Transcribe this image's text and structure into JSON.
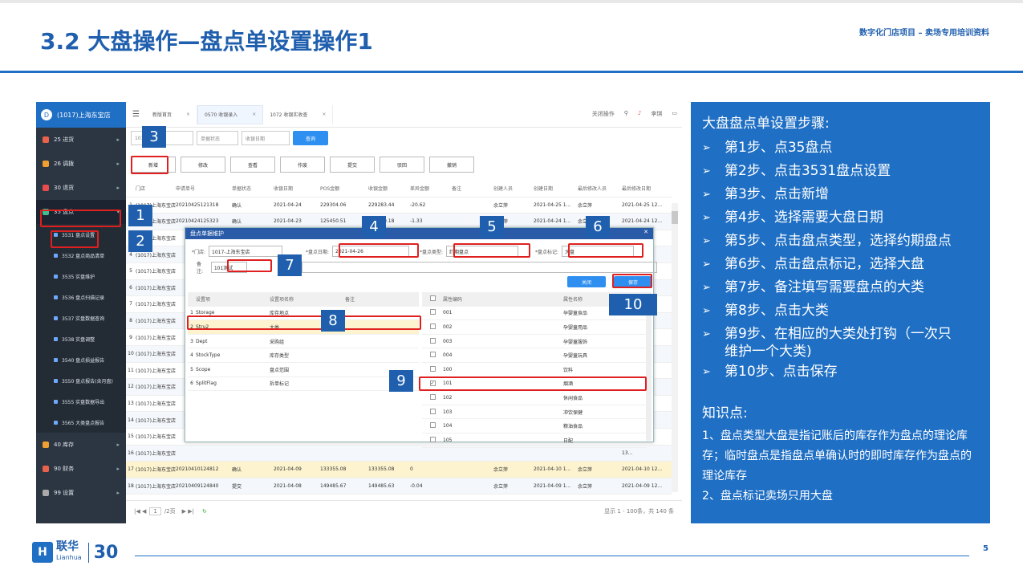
{
  "slide": {
    "title": "3.2 大盘操作—盘点单设置操作1",
    "subtitle": "数字化门店项目 – 卖场专用培训资料",
    "page_number": "5",
    "logo_cn": "联华",
    "logo_en": "Lianhua",
    "logo_years": "30"
  },
  "app": {
    "store_title": "(1017)上海东宝店",
    "menu": [
      {
        "label": "25 进货",
        "icon": "cart-icon",
        "color": "#e8624c"
      },
      {
        "label": "26 调拨",
        "icon": "transfer-icon",
        "color": "#f0a030"
      },
      {
        "label": "30 退货",
        "icon": "return-icon",
        "color": "#e84c4c"
      },
      {
        "label": "35 盘点",
        "icon": "inventory-icon",
        "color": "#3fbf8f"
      }
    ],
    "submenu": [
      "3531 盘点设置",
      "3532 盘点商品清单",
      "3535 实盘维护",
      "3536 盘点扫描记录",
      "3537 实盘数据查询",
      "3538 实盘调整",
      "3540 盘点损益报告",
      "3550 盘点报告(含月盘)",
      "3555 实盘数据导出",
      "3565 大类盘点报告"
    ],
    "menu_bottom": [
      {
        "label": "40 库存",
        "icon": "stock-icon",
        "color": "#f0a030"
      },
      {
        "label": "90 财务",
        "icon": "finance-icon",
        "color": "#e8624c"
      },
      {
        "label": "99 设置",
        "icon": "settings-icon",
        "color": "#aaaaaa"
      }
    ],
    "tabs": [
      "新版首页",
      "0570 收银录入",
      "1072 收银实收查"
    ],
    "topbar_right": [
      "关闭操作",
      "李琪"
    ],
    "filters": {
      "store": "1017",
      "status": "单据状态",
      "date": "收银日期",
      "query": "查询"
    },
    "buttons": [
      "新增",
      "修改",
      "查看",
      "作废",
      "提交",
      "驳回",
      "撤销"
    ],
    "columns": [
      "门店",
      "申请单号",
      "单据状态",
      "收银日期",
      "POS金额",
      "收银金额",
      "差异金额",
      "备注",
      "创建人员",
      "创建日期",
      "最后修改人员",
      "最后修改日期"
    ],
    "rows": [
      [
        "1",
        "(1017)上海东宝店",
        "20210425121318",
        "确认",
        "2021-04-24",
        "229304.06",
        "229283.44",
        "-20.62",
        "",
        "余立萍",
        "2021-04-25 1...",
        "余立萍",
        "2021-04-25 12..."
      ],
      [
        "2",
        "(1017)上海东宝店",
        "20210424125323",
        "确认",
        "2021-04-23",
        "125450.51",
        "125449.18",
        "-1.33",
        "",
        "余立萍",
        "2021-04-24 1...",
        "余立萍",
        "2021-04-24 12..."
      ],
      [
        "3",
        "(1017)上海东宝店",
        "",
        "",
        "",
        "",
        "",
        "",
        "",
        "",
        "",
        "",
        "12..."
      ],
      [
        "4",
        "(1017)上海东宝店",
        "",
        "",
        "",
        "",
        "",
        "",
        "",
        "",
        "",
        "",
        "12..."
      ],
      [
        "5",
        "(1017)上海东宝店",
        "",
        "",
        "",
        "",
        "",
        "",
        "",
        "",
        "",
        "",
        "12..."
      ],
      [
        "6",
        "(1017)上海东宝店",
        "",
        "",
        "",
        "",
        "",
        "",
        "",
        "",
        "",
        "",
        "12..."
      ],
      [
        "7",
        "(1017)上海东宝店",
        "",
        "",
        "",
        "",
        "",
        "",
        "",
        "",
        "",
        "",
        "12..."
      ],
      [
        "8",
        "(1017)上海东宝店",
        "",
        "",
        "",
        "",
        "",
        "",
        "",
        "",
        "",
        "",
        "12..."
      ],
      [
        "9",
        "(1017)上海东宝店",
        "",
        "",
        "",
        "",
        "",
        "",
        "",
        "",
        "",
        "",
        "10..."
      ],
      [
        "10",
        "(1017)上海东宝店",
        "",
        "",
        "",
        "",
        "",
        "",
        "",
        "",
        "",
        "",
        "12..."
      ],
      [
        "11",
        "(1017)上海东宝店",
        "",
        "",
        "",
        "",
        "",
        "",
        "",
        "",
        "",
        "",
        "12..."
      ],
      [
        "12",
        "(1017)上海东宝店",
        "",
        "",
        "",
        "",
        "",
        "",
        "",
        "",
        "",
        "",
        "15..."
      ],
      [
        "13",
        "(1017)上海东宝店",
        "",
        "",
        "",
        "",
        "",
        "",
        "",
        "",
        "",
        "",
        "12..."
      ],
      [
        "14",
        "(1017)上海东宝店",
        "",
        "",
        "",
        "",
        "",
        "",
        "",
        "",
        "",
        "",
        "12..."
      ],
      [
        "15",
        "(1017)上海东宝店",
        "",
        "",
        "",
        "",
        "",
        "",
        "",
        "",
        "",
        "",
        "13..."
      ],
      [
        "16",
        "(1017)上海东宝店",
        "",
        "",
        "",
        "",
        "",
        "",
        "",
        "",
        "",
        "",
        "13..."
      ],
      [
        "17",
        "(1017)上海东宝店",
        "20210410124812",
        "确认",
        "2021-04-09",
        "133355.08",
        "133355.08",
        "0",
        "",
        "余立萍",
        "2021-04-10 1...",
        "余立萍",
        "2021-04-10 12..."
      ],
      [
        "18",
        "(1017)上海东宝店",
        "20210409124840",
        "提交",
        "2021-04-08",
        "149485.67",
        "149485.63",
        "-0.04",
        "",
        "余立萍",
        "2021-04-09 1...",
        "余立萍",
        "2021-04-09 12..."
      ]
    ],
    "pager": {
      "page": "1",
      "pages": "/2页",
      "count": "显示 1 - 100条，共 140 条"
    }
  },
  "dialog": {
    "title": "盘点单据维护",
    "store_label": "*门店:",
    "store_value": "1017-上海东宝店",
    "date_label": "*盘点日期:",
    "date_value": "2021-04-26",
    "type_label": "*盘点类型:",
    "type_value": "约期盘点",
    "flag_label": "*盘点标记:",
    "flag_value": "大盘",
    "note_label": "备注:",
    "note_value": "101测试",
    "close": "关闭",
    "save": "保存",
    "left_headers": [
      "设置项",
      "设置项名称",
      "备注"
    ],
    "left_rows": [
      [
        "1",
        "Storage",
        "库存地点",
        ""
      ],
      [
        "2",
        "Stru2",
        "大类",
        ""
      ],
      [
        "3",
        "Dept",
        "采购组",
        ""
      ],
      [
        "4",
        "StockType",
        "库存类型",
        ""
      ],
      [
        "5",
        "Scope",
        "盘点范围",
        ""
      ],
      [
        "6",
        "SplitFlag",
        "拆单标记",
        ""
      ]
    ],
    "right_headers": [
      "属性编码",
      "属性名称"
    ],
    "right_rows": [
      [
        "001",
        "孕婴童食品"
      ],
      [
        "002",
        "孕婴童用品"
      ],
      [
        "003",
        "孕婴童服饰"
      ],
      [
        "004",
        "孕婴童玩具"
      ],
      [
        "100",
        "饮料"
      ],
      [
        "101",
        "烟酒"
      ],
      [
        "102",
        "休闲食品"
      ],
      [
        "103",
        "冲饮保健"
      ],
      [
        "104",
        "粮油食品"
      ],
      [
        "105",
        "日配"
      ]
    ]
  },
  "markers": [
    "1",
    "2",
    "3",
    "4",
    "5",
    "6",
    "7",
    "8",
    "9",
    "10"
  ],
  "panel": {
    "heading": "大盘盘点单设置步骤:",
    "bullet": "➢",
    "steps": [
      "第1步、点35盘点",
      "第2步、点击3531盘点设置",
      "第3步、点击新增",
      "第4步、选择需要大盘日期",
      "第5步、点击盘点类型，选择约期盘点",
      "第6步、点击盘点标记，选择大盘",
      "第7步、备注填写需要盘点的大类",
      "第8步、点击大类",
      "第9步、在相应的大类处打钩（一次只",
      "第10步、点击保存"
    ],
    "step9_cont": "维护一个大类)",
    "knowledge_heading": "知识点:",
    "knowledge": [
      "1、盘点类型大盘是指记账后的库存作为盘点的理论库存；临时盘点是指盘点单确认时的即时库存作为盘点的理论库存",
      "2、盘点标记卖场只用大盘"
    ]
  },
  "colors": {
    "brand": "#1f6fc4",
    "title": "#1f5fae",
    "highlight": "#e02020",
    "sidebar": "#2c3643"
  }
}
